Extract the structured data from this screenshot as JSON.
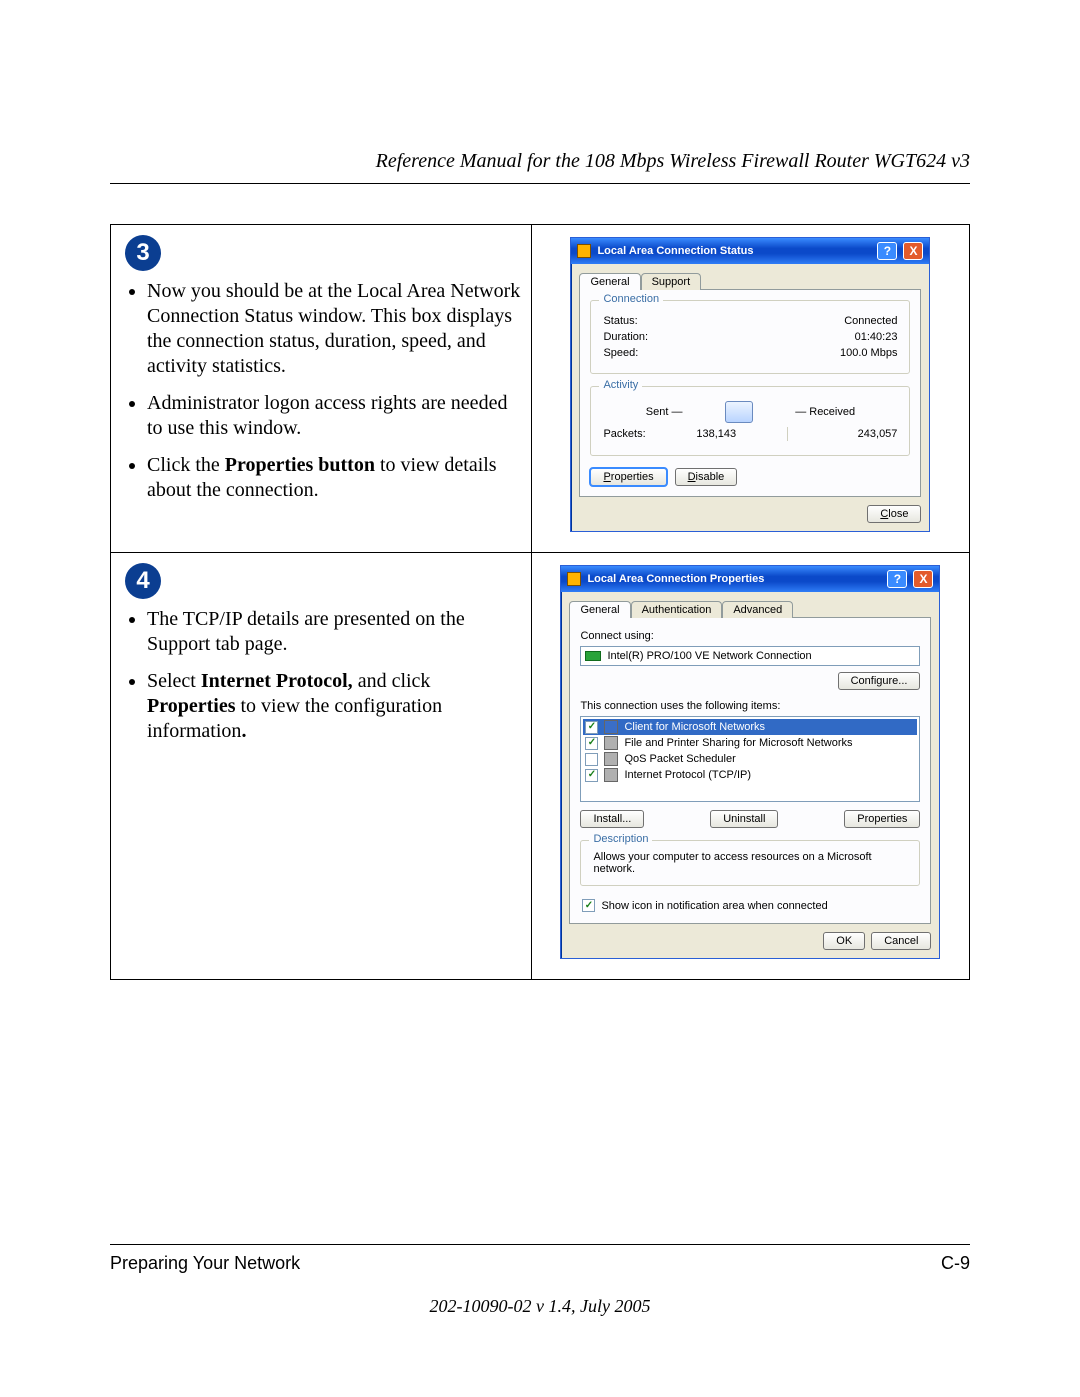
{
  "header": {
    "title": "Reference Manual for the 108 Mbps Wireless Firewall Router WGT624 v3"
  },
  "steps": {
    "s3": {
      "num": "3",
      "b1": "Now you should be at the Local Area Network Connection Status window. This box displays the connection status, duration, speed, and activity statistics.",
      "b2": "Administrator logon access rights are needed to use this window.",
      "b3_pre": "Click the ",
      "b3_bold": "Properties button",
      "b3_post": " to view details about the connection."
    },
    "s4": {
      "num": "4",
      "b1": "The TCP/IP details are presented on the Support tab page.",
      "b2_pre": "Select ",
      "b2_bold1": "Internet Protocol,",
      "b2_mid": " and click ",
      "b2_bold2": "Properties",
      "b2_post": " to view the configuration information",
      "b2_dot": "."
    }
  },
  "win_status": {
    "title": "Local Area Connection Status",
    "tabs": {
      "general": "General",
      "support": "Support"
    },
    "conn_legend": "Connection",
    "status_l": "Status:",
    "status_v": "Connected",
    "duration_l": "Duration:",
    "duration_v": "01:40:23",
    "speed_l": "Speed:",
    "speed_v": "100.0 Mbps",
    "act_legend": "Activity",
    "sent": "Sent",
    "received": "Received",
    "packets_l": "Packets:",
    "packets_sent": "138,143",
    "packets_recv": "243,057",
    "btn_properties": "Properties",
    "btn_disable": "Disable",
    "btn_close": "Close"
  },
  "win_props": {
    "title": "Local Area Connection Properties",
    "tabs": {
      "general": "General",
      "auth": "Authentication",
      "adv": "Advanced"
    },
    "connect_using": "Connect using:",
    "adapter": "Intel(R) PRO/100 VE Network Connection",
    "configure": "Configure...",
    "items_label": "This connection uses the following items:",
    "items": [
      {
        "checked": true,
        "label": "Client for Microsoft Networks",
        "sel": true
      },
      {
        "checked": true,
        "label": "File and Printer Sharing for Microsoft Networks",
        "sel": false
      },
      {
        "checked": false,
        "label": "QoS Packet Scheduler",
        "sel": false
      },
      {
        "checked": true,
        "label": "Internet Protocol (TCP/IP)",
        "sel": false
      }
    ],
    "install": "Install...",
    "uninstall": "Uninstall",
    "properties": "Properties",
    "desc_legend": "Description",
    "desc_text": "Allows your computer to access resources on a Microsoft network.",
    "show_icon": "Show icon in notification area when connected",
    "ok": "OK",
    "cancel": "Cancel"
  },
  "footer": {
    "section": "Preparing Your Network",
    "pagenum": "C-9",
    "docmeta": "202-10090-02 v 1.4, July 2005"
  }
}
